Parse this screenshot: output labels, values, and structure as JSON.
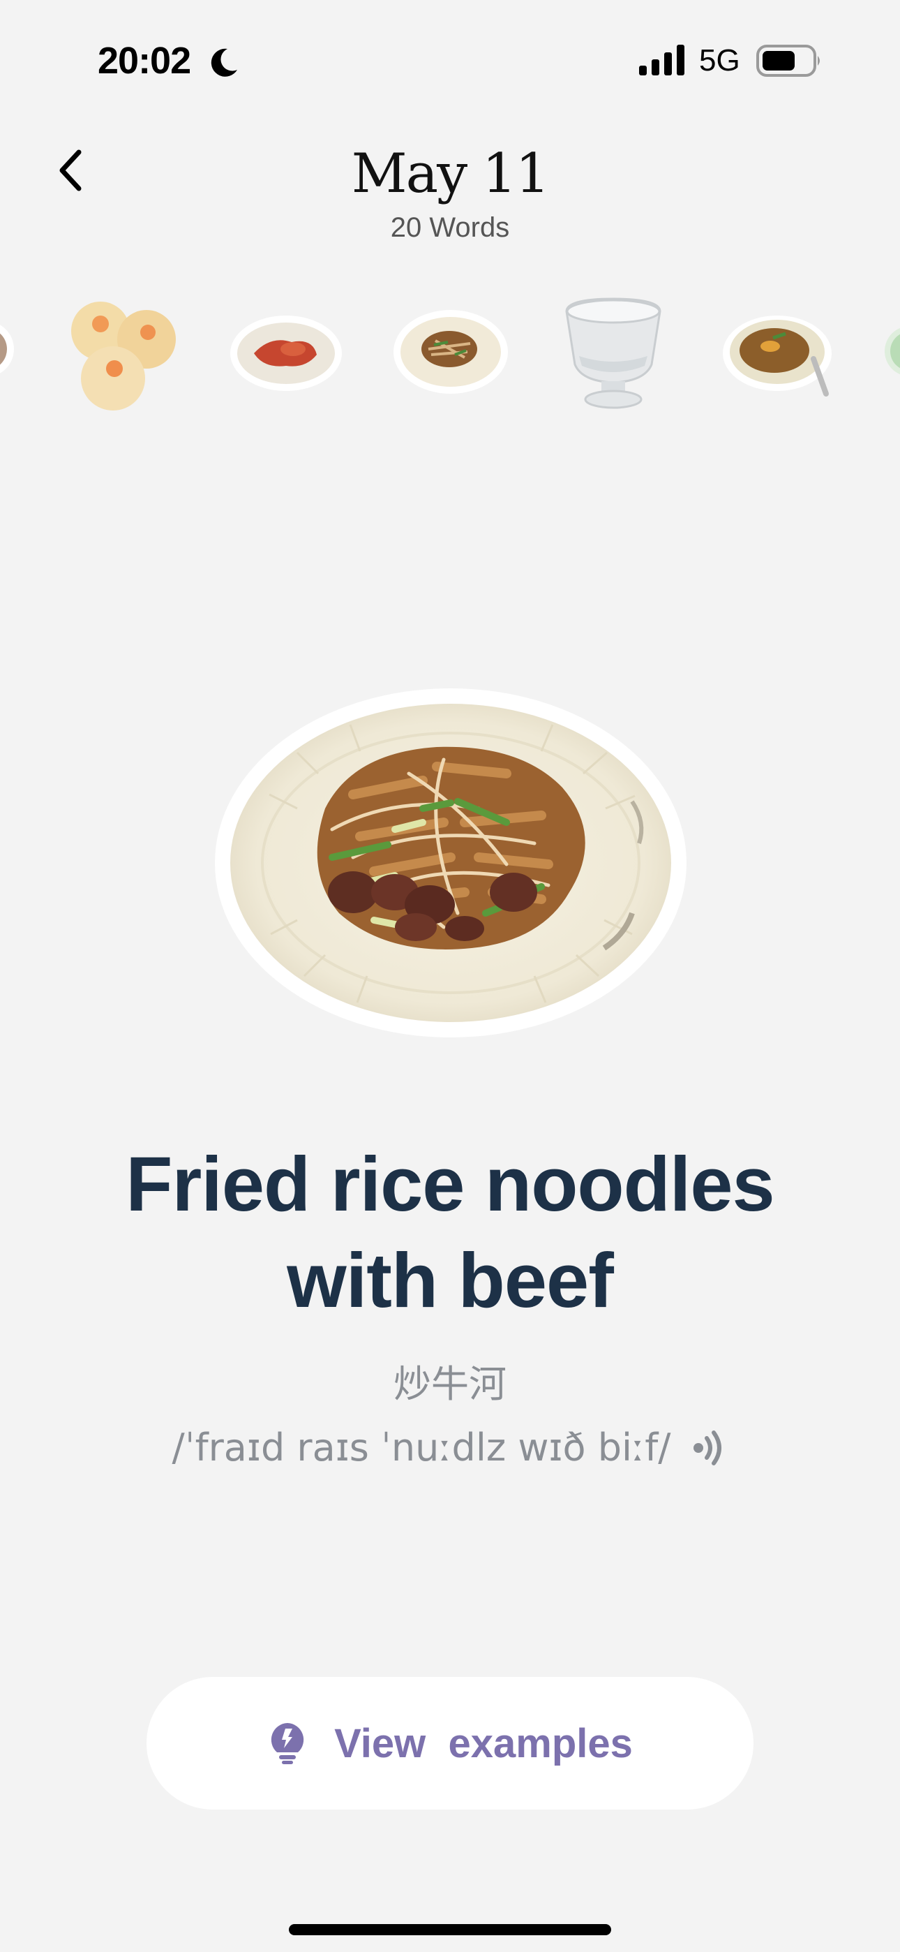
{
  "status_bar": {
    "time": "20:02",
    "network": "5G",
    "focus_icon": "moon-icon",
    "signal_icon": "signal-bars-icon",
    "battery_icon": "battery-icon"
  },
  "header": {
    "back_icon": "chevron-left-icon",
    "title": "May 11",
    "subtitle": "20 Words"
  },
  "carousel": {
    "items": [
      "dish-partial",
      "siu-mai",
      "red-dish-plate",
      "fried-rice-noodles",
      "water-glass",
      "braised-dish-bowl",
      "dish-partial"
    ],
    "selected_index": 3
  },
  "word": {
    "english_line1": "Fried rice noodles",
    "english_line2": "with beef",
    "chinese": "炒牛河",
    "pronunciation": "/ˈfraɪd raɪs ˈnuːdlz wɪð biːf/",
    "sound_icon": "speaker-icon"
  },
  "actions": {
    "view_examples": "View  examples",
    "bulb_icon": "lightbulb-icon"
  },
  "colors": {
    "background": "#f3f3f3",
    "title_text": "#1d3147",
    "secondary_text": "#8a8e94",
    "accent": "#7c71ad"
  }
}
